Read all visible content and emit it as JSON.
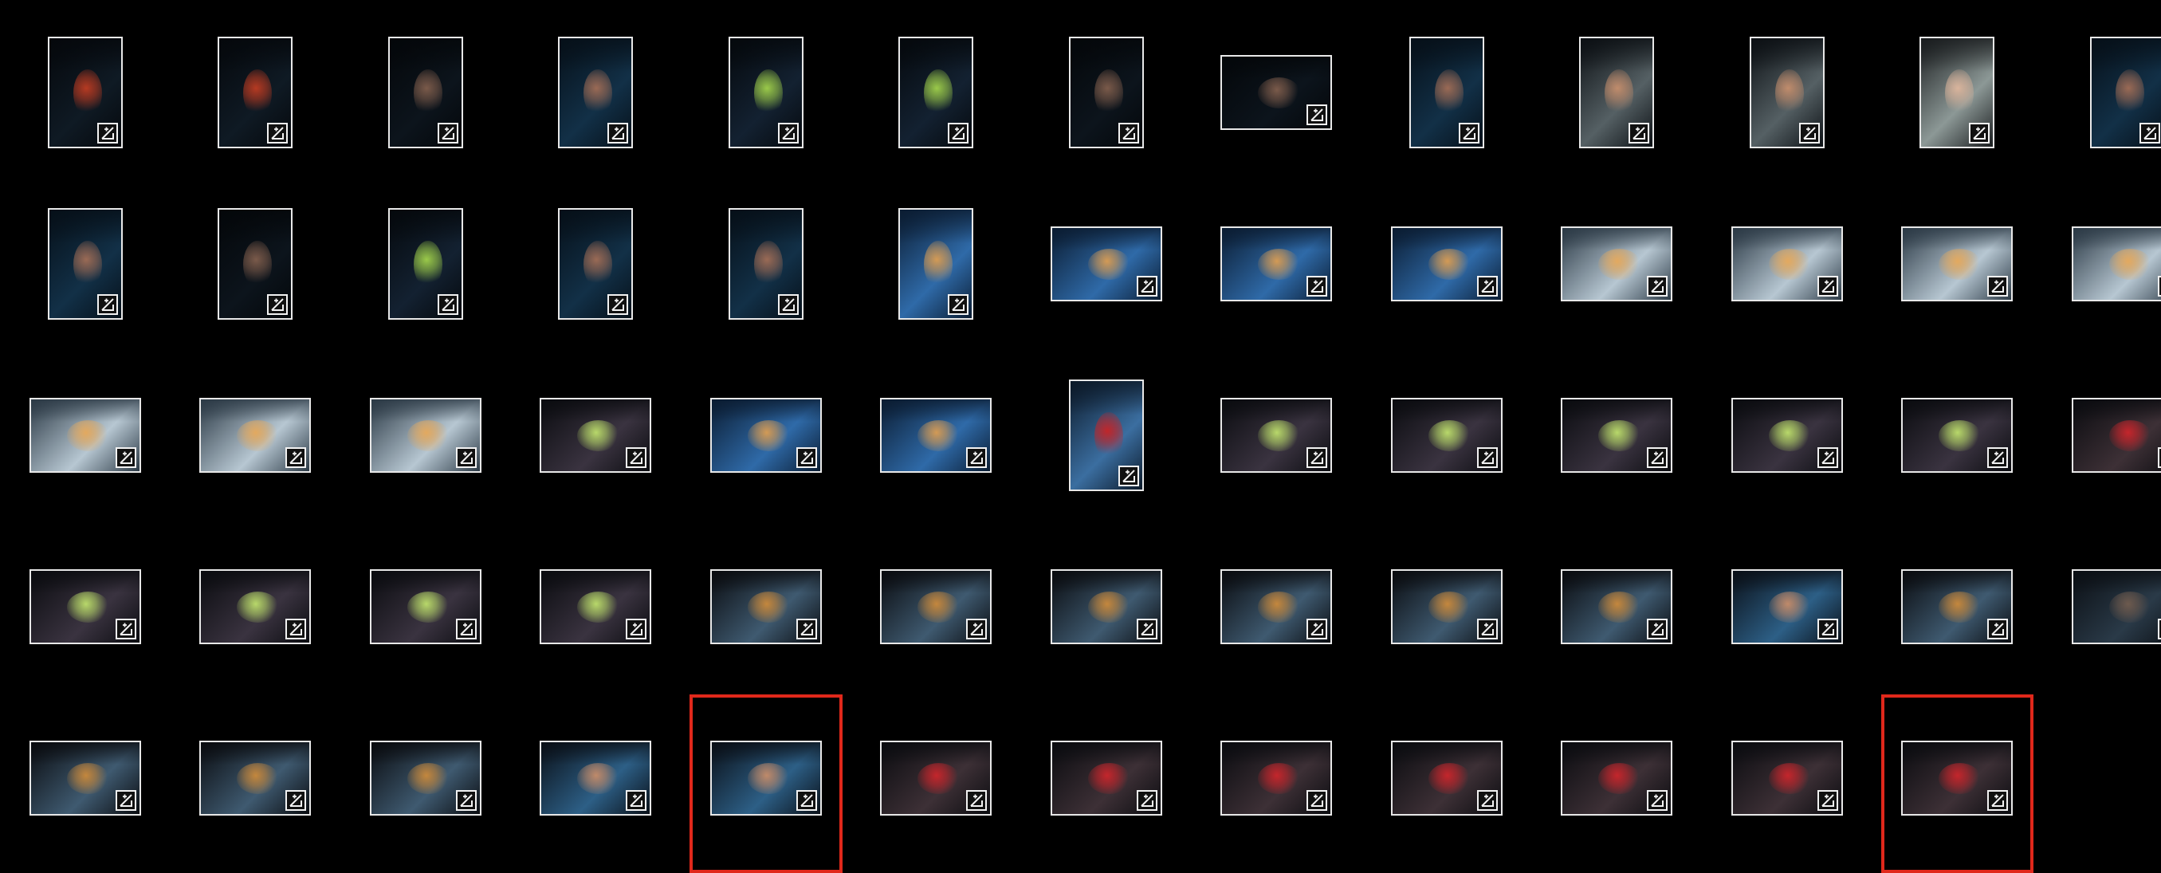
{
  "gallery": {
    "columns": 13,
    "badge_icon": "edit-adjust-icon",
    "selection_color": "#e0281b",
    "thumbnails": [
      {
        "o": "p",
        "scene": "dark-cap"
      },
      {
        "o": "p",
        "scene": "dark-cap"
      },
      {
        "o": "p",
        "scene": "dark"
      },
      {
        "o": "p",
        "scene": "dark-blue"
      },
      {
        "o": "p",
        "scene": "dark-apple"
      },
      {
        "o": "p",
        "scene": "dark-apple"
      },
      {
        "o": "p",
        "scene": "dark"
      },
      {
        "o": "l",
        "scene": "dark"
      },
      {
        "o": "p",
        "scene": "dark-blue"
      },
      {
        "o": "p",
        "scene": "grey"
      },
      {
        "o": "p",
        "scene": "grey"
      },
      {
        "o": "p",
        "scene": "grey-light"
      },
      {
        "o": "p",
        "scene": "dark-blue"
      },
      {
        "o": "p",
        "scene": "dark-blue"
      },
      {
        "o": "p",
        "scene": "dark"
      },
      {
        "o": "p",
        "scene": "dark-apple"
      },
      {
        "o": "p",
        "scene": "dark-blue"
      },
      {
        "o": "p",
        "scene": "dark-blue"
      },
      {
        "o": "p",
        "scene": "street"
      },
      {
        "o": "l",
        "scene": "street"
      },
      {
        "o": "l",
        "scene": "street"
      },
      {
        "o": "l",
        "scene": "street"
      },
      {
        "o": "l",
        "scene": "street-light"
      },
      {
        "o": "l",
        "scene": "street-light"
      },
      {
        "o": "l",
        "scene": "street-light"
      },
      {
        "o": "l",
        "scene": "street-light"
      },
      {
        "o": "l",
        "scene": "street-light"
      },
      {
        "o": "l",
        "scene": "street-light"
      },
      {
        "o": "l",
        "scene": "street-light"
      },
      {
        "o": "l",
        "scene": "hands"
      },
      {
        "o": "l",
        "scene": "street"
      },
      {
        "o": "l",
        "scene": "street"
      },
      {
        "o": "p",
        "scene": "street-apple"
      },
      {
        "o": "l",
        "scene": "hands"
      },
      {
        "o": "l",
        "scene": "hands"
      },
      {
        "o": "l",
        "scene": "hands"
      },
      {
        "o": "l",
        "scene": "hands"
      },
      {
        "o": "l",
        "scene": "hands"
      },
      {
        "o": "l",
        "scene": "hands-apple"
      },
      {
        "o": "l",
        "scene": "hands"
      },
      {
        "o": "l",
        "scene": "hands"
      },
      {
        "o": "l",
        "scene": "hands"
      },
      {
        "o": "l",
        "scene": "hands"
      },
      {
        "o": "l",
        "scene": "cap-warm"
      },
      {
        "o": "l",
        "scene": "cap-warm"
      },
      {
        "o": "l",
        "scene": "cap-warm"
      },
      {
        "o": "l",
        "scene": "cap-warm"
      },
      {
        "o": "l",
        "scene": "cap-warm"
      },
      {
        "o": "l",
        "scene": "cap-warm"
      },
      {
        "o": "l",
        "scene": "cap-cool"
      },
      {
        "o": "l",
        "scene": "cap-warm"
      },
      {
        "o": "l",
        "scene": "cap-dim"
      },
      {
        "o": "l",
        "scene": "cap-warm"
      },
      {
        "o": "l",
        "scene": "cap-warm"
      },
      {
        "o": "l",
        "scene": "cap-warm"
      },
      {
        "o": "l",
        "scene": "cap-cool"
      },
      {
        "o": "l",
        "scene": "cap-cool",
        "selected": true
      },
      {
        "o": "l",
        "scene": "hands-apple"
      },
      {
        "o": "l",
        "scene": "hands-apple"
      },
      {
        "o": "l",
        "scene": "hands-apple"
      },
      {
        "o": "l",
        "scene": "hands-apple"
      },
      {
        "o": "l",
        "scene": "hands-apple"
      },
      {
        "o": "l",
        "scene": "hands-apple"
      },
      {
        "o": "l",
        "scene": "hands-apple",
        "selected": true
      }
    ],
    "palettes": {
      "dark-cap": [
        "#05080c",
        "#0f1a24",
        "#b53a22"
      ],
      "dark": [
        "#04070a",
        "#0c141c",
        "#7a5a4a"
      ],
      "dark-blue": [
        "#061019",
        "#123047",
        "#9a6a55"
      ],
      "dark-apple": [
        "#05090d",
        "#132131",
        "#9ac94a"
      ],
      "grey": [
        "#0c1014",
        "#556064",
        "#c08c6c"
      ],
      "grey-light": [
        "#1a1d1f",
        "#8c9896",
        "#d9b49c"
      ],
      "street": [
        "#0b1d33",
        "#2f6aa8",
        "#d39a55"
      ],
      "street-light": [
        "#2c3a46",
        "#b7c7d2",
        "#e3a95f"
      ],
      "street-apple": [
        "#0c1a2a",
        "#3b6ea0",
        "#c0262a"
      ],
      "hands": [
        "#0b0c10",
        "#3a3340",
        "#b8d86a"
      ],
      "hands-apple": [
        "#0b0c10",
        "#3d3036",
        "#c4262c"
      ],
      "cap-warm": [
        "#0a0c10",
        "#3f5a70",
        "#c4873d"
      ],
      "cap-cool": [
        "#0a1018",
        "#2d5f86",
        "#c08a6a"
      ],
      "cap-dim": [
        "#0b0f14",
        "#2a3a48",
        "#6d5a4e"
      ]
    }
  }
}
